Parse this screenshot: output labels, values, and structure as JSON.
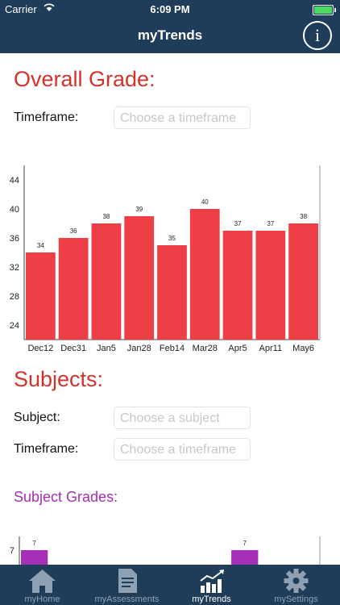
{
  "status_bar": {
    "carrier": "Carrier",
    "time": "6:09 PM"
  },
  "nav": {
    "title": "myTrends",
    "info_glyph": "i"
  },
  "overall": {
    "heading": "Overall Grade:",
    "timeframe_label": "Timeframe:",
    "timeframe_placeholder": "Choose a timeframe"
  },
  "subjects": {
    "heading": "Subjects:",
    "subject_label": "Subject:",
    "subject_placeholder": "Choose a subject",
    "timeframe_label": "Timeframe:",
    "timeframe_placeholder": "Choose a timeframe",
    "grades_heading": "Subject Grades:"
  },
  "chart_data": [
    {
      "type": "bar",
      "categories": [
        "Dec12",
        "Dec31",
        "Jan5",
        "Jan28",
        "Feb14",
        "Mar28",
        "Apr5",
        "Apr11",
        "May6"
      ],
      "values": [
        34,
        36,
        38,
        39,
        35,
        40,
        37,
        37,
        38
      ],
      "ylim": [
        22,
        46
      ],
      "yticks": [
        24,
        28,
        32,
        36,
        40,
        44
      ],
      "color": "#f03e47"
    },
    {
      "type": "bar",
      "categories": [
        "",
        "",
        "",
        "",
        "",
        "",
        "",
        "",
        "",
        ""
      ],
      "values": [
        7,
        0,
        0,
        0,
        0,
        0,
        0,
        7,
        0,
        0
      ],
      "yticks": [
        7
      ],
      "color": "#a52fb7",
      "note": "partially visible, cut off by tab bar"
    }
  ],
  "tabs": [
    {
      "label": "myHome",
      "icon": "home-icon",
      "active": false
    },
    {
      "label": "myAssessments",
      "icon": "document-icon",
      "active": false
    },
    {
      "label": "myTrends",
      "icon": "trend-chart-icon",
      "active": true
    },
    {
      "label": "mySettings",
      "icon": "gear-icon",
      "active": false
    }
  ]
}
